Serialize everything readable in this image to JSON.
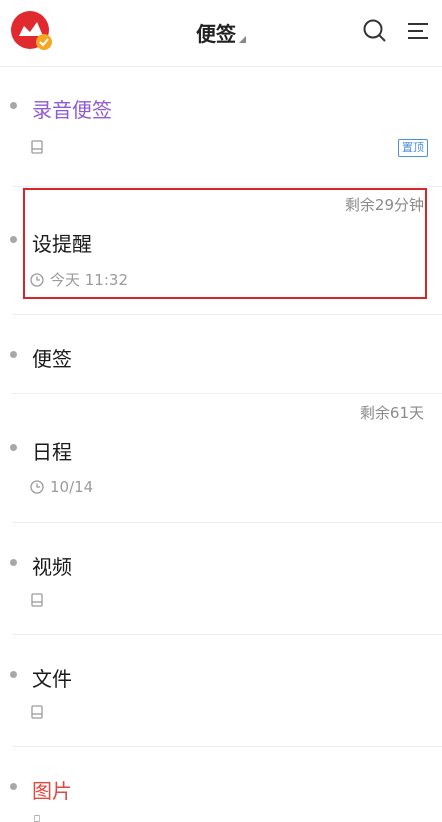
{
  "header": {
    "title": "便签"
  },
  "notes": [
    {
      "title": "录音便签",
      "pin_label": "置顶"
    },
    {
      "title": "设提醒",
      "remaining": "剩余29分钟",
      "date": "今天 11:32"
    },
    {
      "title": "便签"
    },
    {
      "title": "日程",
      "remaining": "剩余61天",
      "date": "10/14"
    },
    {
      "title": "视频"
    },
    {
      "title": "文件"
    },
    {
      "title": "图片"
    }
  ],
  "colors": {
    "accent_purple": "#8e5ad6",
    "accent_red": "#e2473f",
    "highlight": "#d8252a",
    "pin_blue": "#4a8fe0"
  }
}
